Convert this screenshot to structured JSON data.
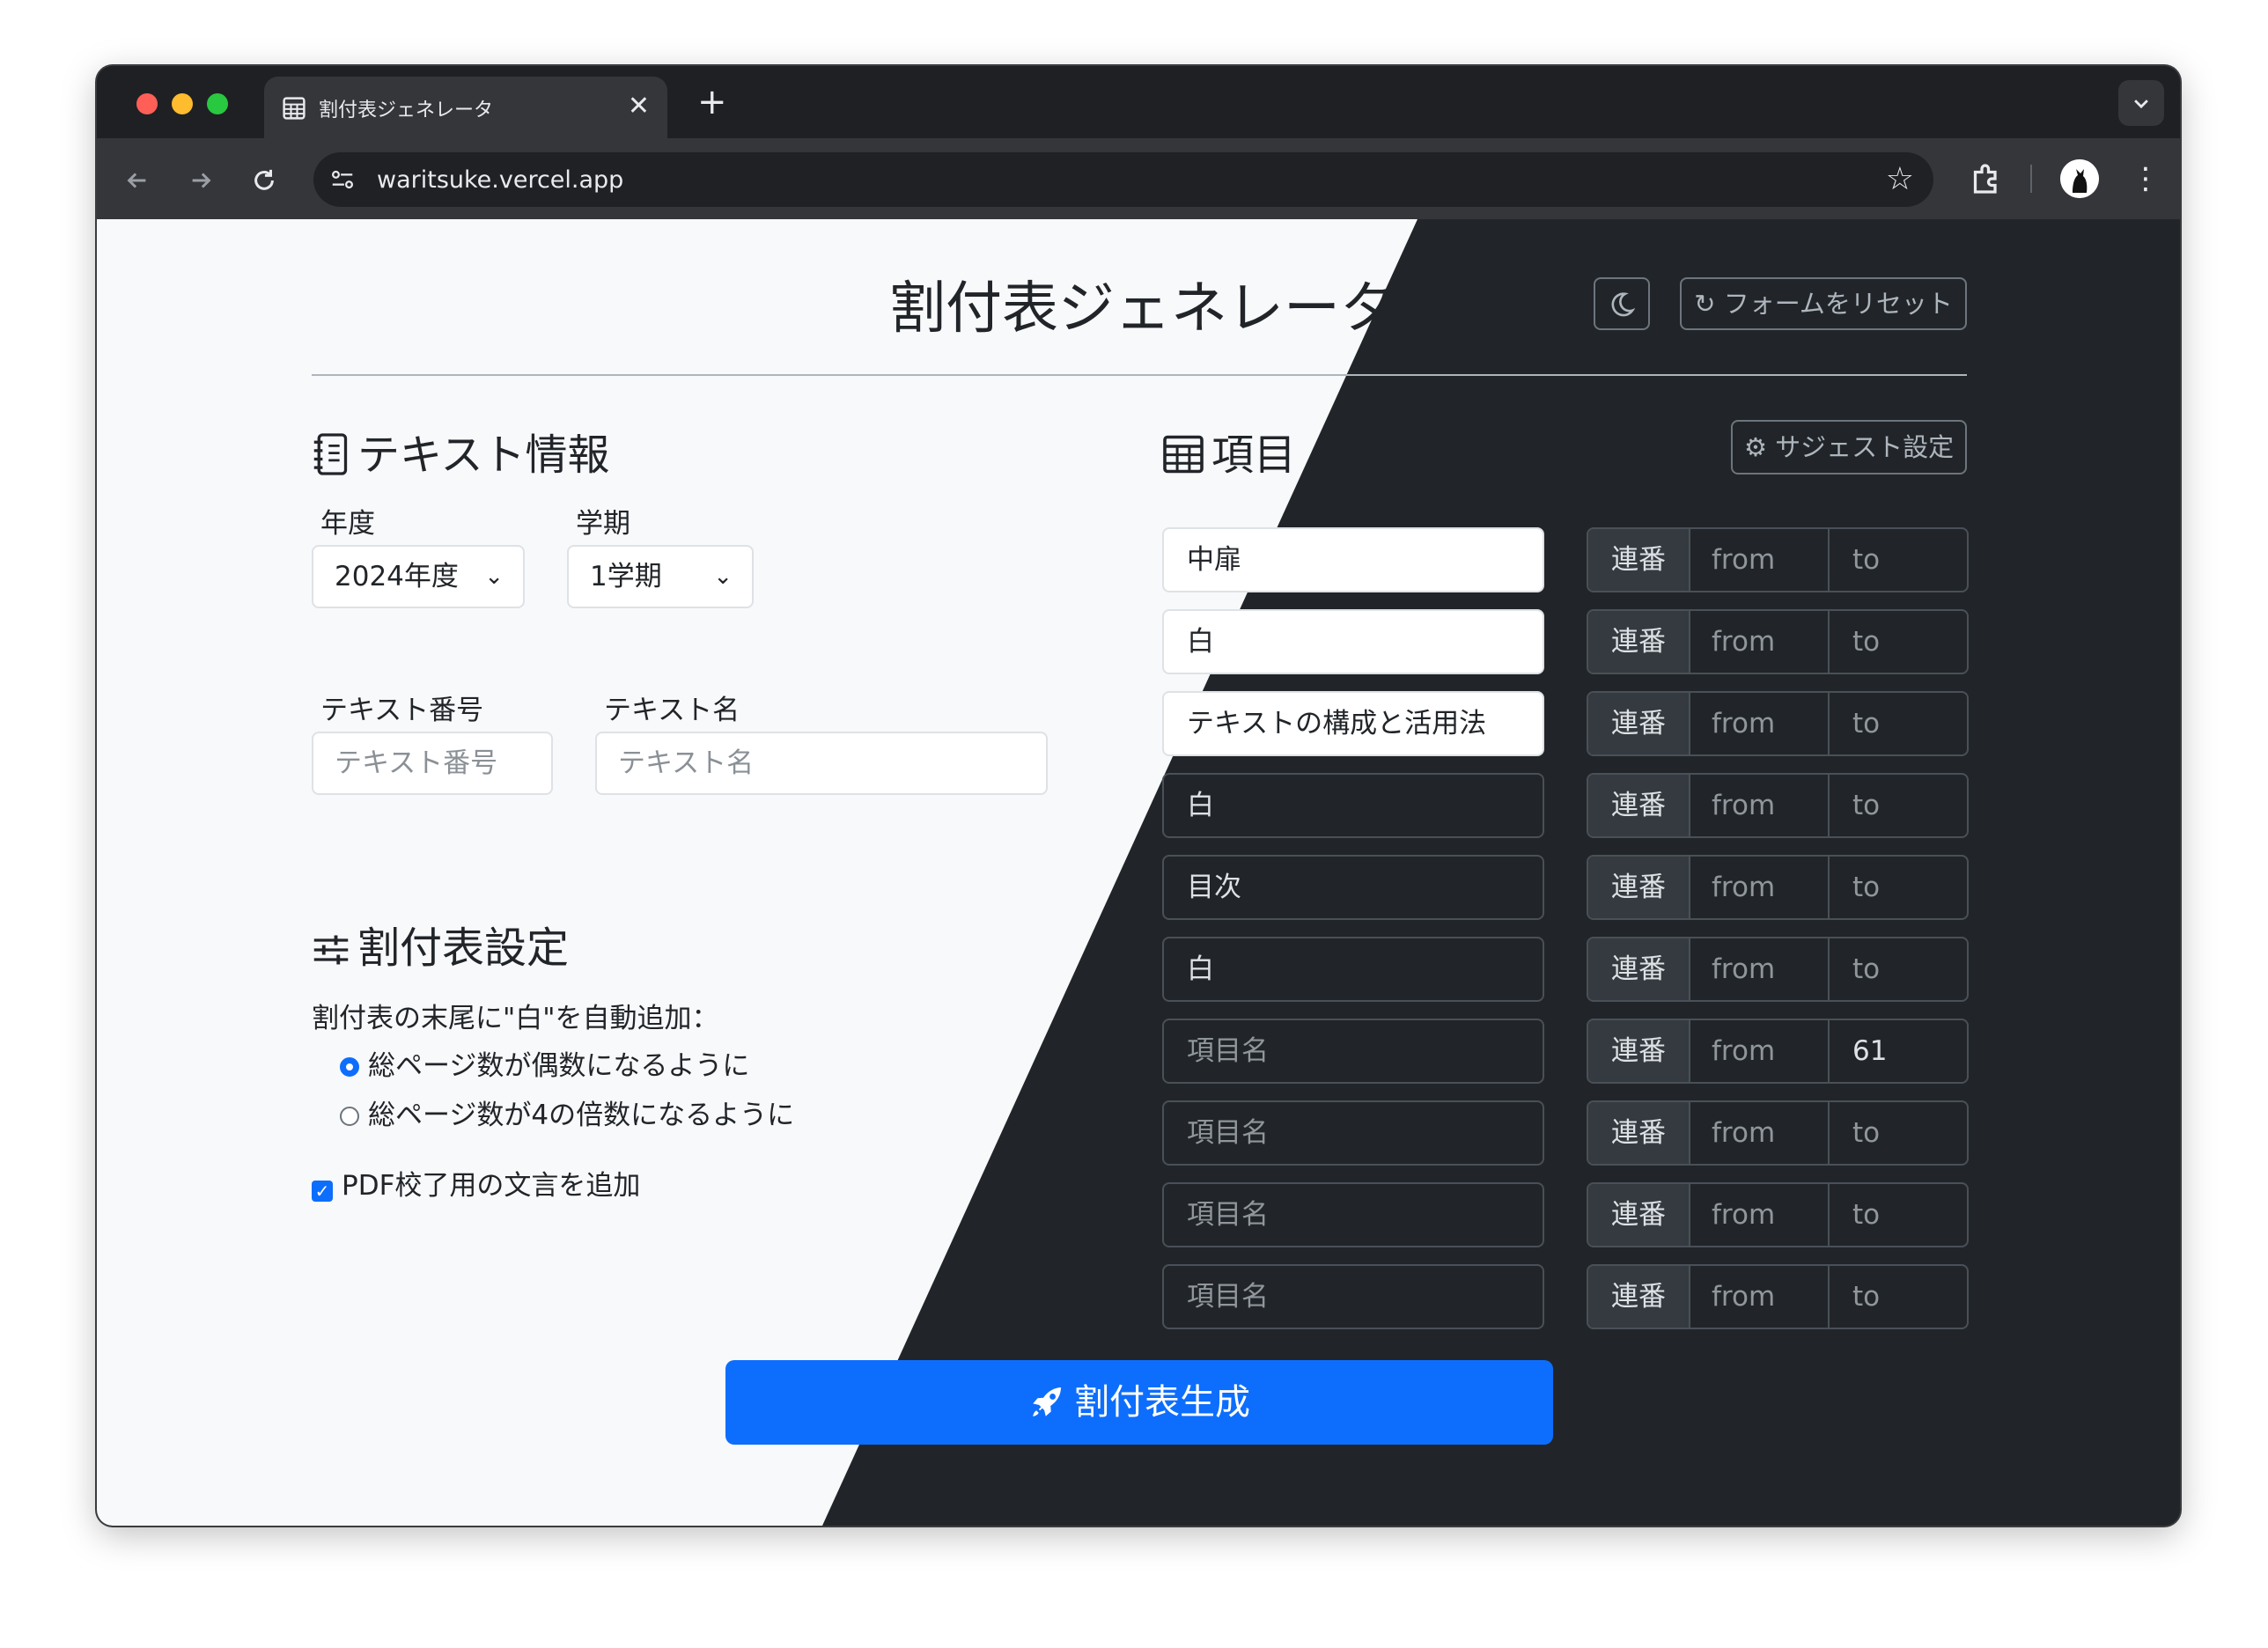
{
  "browser": {
    "tab_title": "割付表ジェネレータ",
    "tab_close": "✕",
    "new_tab": "+",
    "url": "waritsuke.vercel.app"
  },
  "page": {
    "title": "割付表ジェネレータ",
    "reset_button": "フォームをリセット",
    "text_info": {
      "heading": "テキスト情報",
      "year_label": "年度",
      "year_value": "2024年度",
      "term_label": "学期",
      "term_value": "1学期",
      "number_label": "テキスト番号",
      "number_placeholder": "テキスト番号",
      "name_label": "テキスト名",
      "name_placeholder": "テキスト名"
    },
    "settings": {
      "heading": "割付表設定",
      "auto_add_label": "割付表の末尾に\"白\"を自動追加：",
      "options": [
        {
          "label": "総ページ数が偶数になるように",
          "selected": true
        },
        {
          "label": "総ページ数が4の倍数になるように",
          "selected": false
        }
      ],
      "pdf_checkbox_label": "PDF校了用の文言を追加",
      "pdf_checked": true
    },
    "items": {
      "heading": "項目",
      "suggest_button": "サジェスト設定",
      "rows": [
        {
          "name": "中扉",
          "placeholder": false,
          "group": "連番",
          "from": "from",
          "to": "to"
        },
        {
          "name": "白",
          "placeholder": false,
          "group": "連番",
          "from": "from",
          "to": "to"
        },
        {
          "name": "テキストの構成と活用法",
          "placeholder": false,
          "group": "連番",
          "from": "from",
          "to": "to"
        },
        {
          "name": "白",
          "placeholder": false,
          "group": "連番",
          "from": "from",
          "to": "to"
        },
        {
          "name": "目次",
          "placeholder": false,
          "group": "連番",
          "from": "from",
          "to": "to"
        },
        {
          "name": "白",
          "placeholder": false,
          "group": "連番",
          "from": "from",
          "to": "to"
        },
        {
          "name": "項目名",
          "placeholder": true,
          "group": "連番",
          "from": "from",
          "to": "61"
        },
        {
          "name": "項目名",
          "placeholder": true,
          "group": "連番",
          "from": "from",
          "to": "to"
        },
        {
          "name": "項目名",
          "placeholder": true,
          "group": "連番",
          "from": "from",
          "to": "to"
        },
        {
          "name": "項目名",
          "placeholder": true,
          "group": "連番",
          "from": "from",
          "to": "to"
        }
      ]
    },
    "generate_button": "割付表生成"
  },
  "colors": {
    "light_bg": "#f8f9fa",
    "dark_bg": "#212529",
    "primary": "#0d6efd"
  },
  "icons": [
    "grid-icon",
    "site-settings-icon",
    "star-icon",
    "extensions-icon",
    "avatar-icon",
    "kebab-menu-icon",
    "moon-icon",
    "reset-icon",
    "journal-icon",
    "table-icon",
    "gear-icon",
    "sliders-icon",
    "rocket-icon"
  ]
}
